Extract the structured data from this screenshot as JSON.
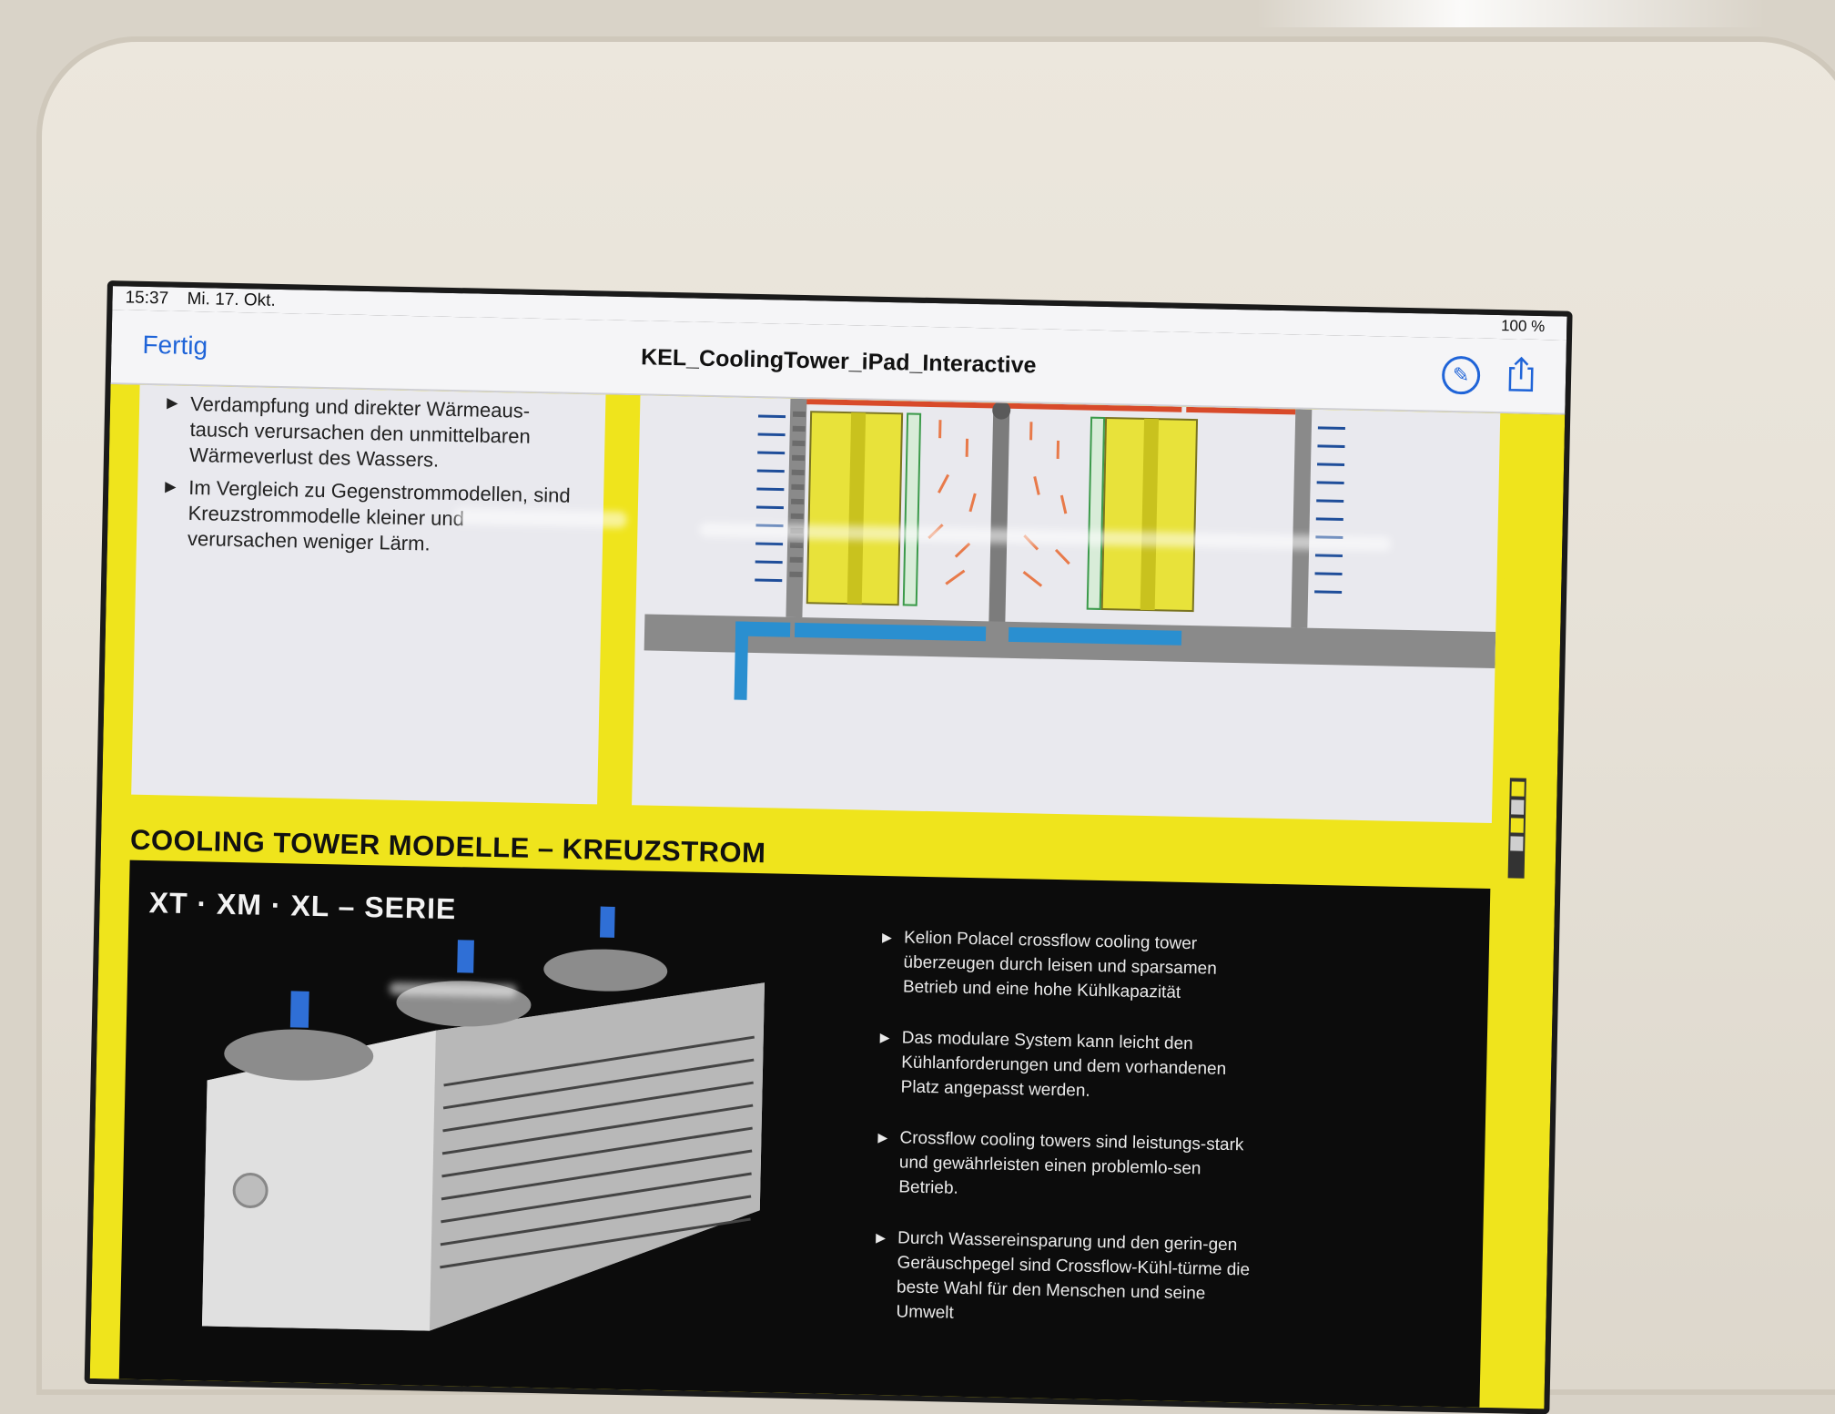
{
  "status_bar": {
    "time": "15:37",
    "date": "Mi. 17. Okt.",
    "battery": "100 %"
  },
  "nav": {
    "done_label": "Fertig",
    "title": "KEL_CoolingTower_iPad_Interactive",
    "markup_icon": "markup-pen-icon",
    "share_icon": "share-icon"
  },
  "intro_bullets": [
    "Verdampfung und direkter Wärmeaus-tausch verursachen den unmittelbaren Wärmeverlust des Wassers.",
    "Im Vergleich zu Gegenstrommodellen, sind Kreuzstrommodelle kleiner und verursachen weniger Lärm."
  ],
  "section_heading": "COOLING TOWER MODELLE – KREUZSTROM",
  "series_label": "XT · XM · XL –  SERIE",
  "product_bullets": [
    "Kelion Polacel crossflow cooling tower überzeugen durch leisen und sparsamen Betrieb und eine hohe Kühlkapazität",
    "Das modulare System kann leicht den Kühlanforderungen und dem vorhandenen Platz angepasst werden.",
    "Crossflow cooling towers sind leistungs-stark und gewährleisten einen problemlo-sen Betrieb.",
    "Durch Wassereinsparung und den gerin-gen Geräuschpegel sind Crossflow-Kühl-türme die beste Wahl  für den Menschen und seine Umwelt"
  ],
  "colors": {
    "accent_yellow": "#efe41c",
    "ios_blue": "#1f64d8",
    "water_blue": "#2a8fd0",
    "warm_arrow": "#e87a4a",
    "cold_arrow": "#1f4e9a"
  }
}
